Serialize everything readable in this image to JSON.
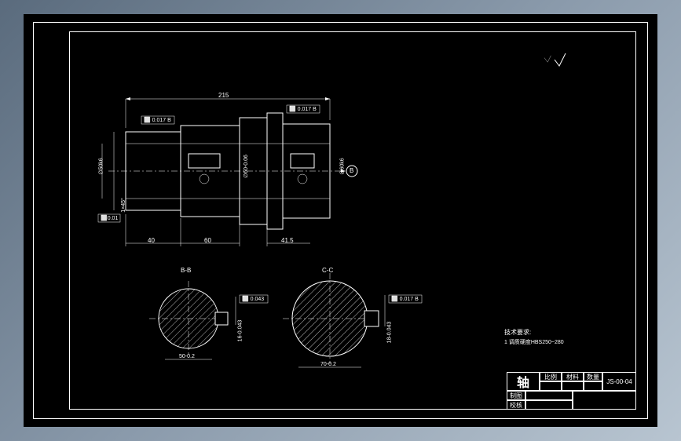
{
  "drawing": {
    "main_dim_top": "215",
    "dim_40_left": "40",
    "dim_60": "60",
    "dim_415": "41.5",
    "gdtol_a": "⬜ 0.017 B",
    "gdtol_b": "⬜ 0.017 B",
    "dia_left": "∅50k6",
    "dia_mid": "∅60-0.06",
    "dia_right": "∅60k6",
    "datum_b": "B",
    "chamfer_1": "1×45°",
    "section_b": "B-B",
    "section_c": "C-C",
    "sec_b_dim_h": "50-0.2",
    "sec_b_dim_w": "16-0.043",
    "sec_b_tol": "⬜ 0.043",
    "sec_c_dim_h": "70-0.2",
    "sec_c_dim_w": "18-0.043",
    "sec_c_tol": "⬜ 0.017 B",
    "surface_mark": "√",
    "tech_req_title": "技术要求:",
    "tech_req_1": "1 调质硬度HBS250~280"
  },
  "title_block": {
    "part_name": "轴",
    "col_scale": "比例",
    "col_material": "材料",
    "col_qty": "数量",
    "drawing_no": "JS-00-04",
    "label_draw": "制图",
    "label_check": "校核"
  }
}
